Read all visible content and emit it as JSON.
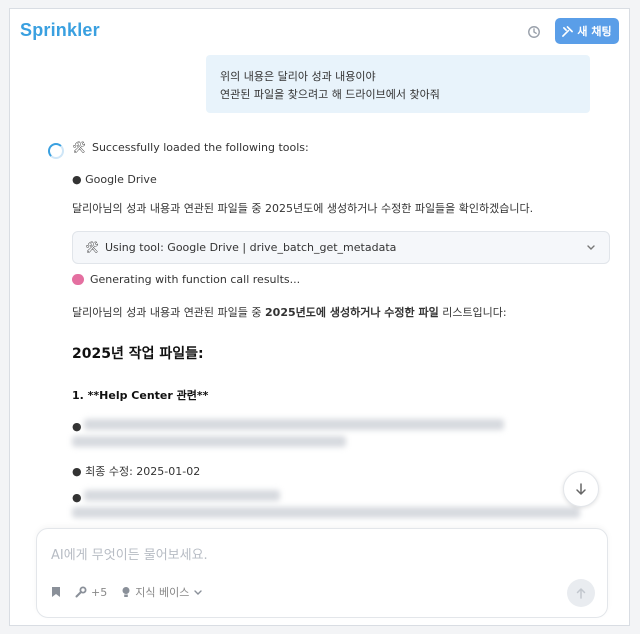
{
  "header": {
    "brand": "Sprinkler",
    "new_chat_label": "새 채팅"
  },
  "user_message": {
    "line1": "위의 내용은 달리아 성과 내용이야",
    "line2": "연관된 파일을 찾으려고 해 드라이브에서 찾아줘"
  },
  "assistant": {
    "tools_loaded": "Successfully loaded the following tools:",
    "tool_item": "● Google Drive",
    "intro": "달리아님의 성과 내용과 연관된 파일들 중 2025년도에 생성하거나 수정한 파일들을 확인하겠습니다.",
    "tool_use": "Using tool: Google Drive | drive_batch_get_metadata",
    "generating": "Generating with function call results...",
    "result_prefix": "달리아님의 성과 내용과 연관된 파일들 중 ",
    "result_bold": "2025년도에 생성하거나 수정한 파일",
    "result_suffix": " 리스트입니다:",
    "heading": "2025년 작업 파일들:",
    "list_item_1": "1. **Help Center 관련**",
    "bullet_marker": "●",
    "modified_label": "● 최종 수정: 2025-01-02"
  },
  "input": {
    "placeholder": "AI에게 무엇이든 물어보세요.",
    "tools_count": "+5",
    "knowledge_label": "지식 베이스"
  },
  "colors": {
    "brand": "#3aa0e0",
    "primary_button": "#5a9ee8",
    "user_bubble": "#e8f3fb"
  }
}
